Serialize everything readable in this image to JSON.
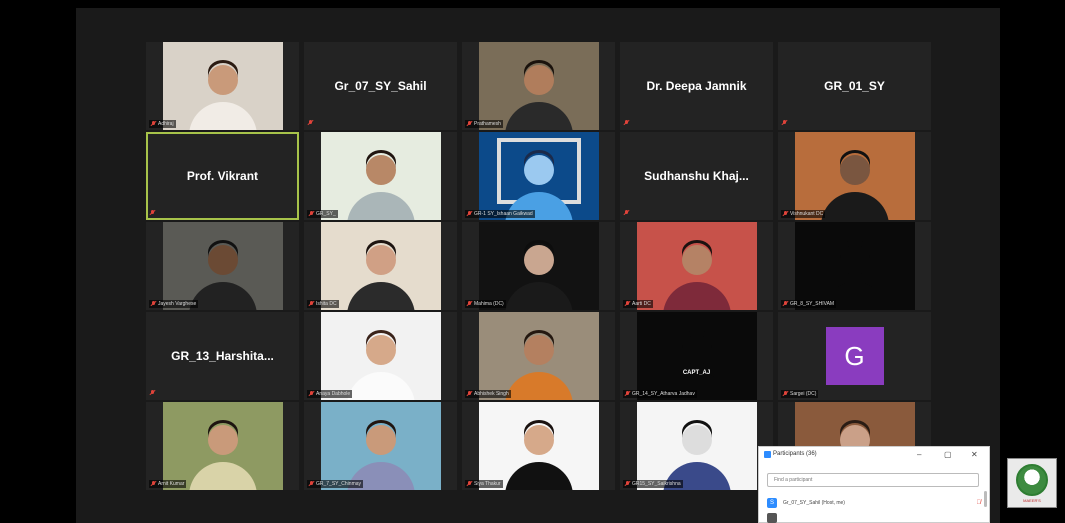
{
  "tiles": [
    {
      "type": "video",
      "label": "Adhiraj",
      "bg": "#d9d2c8",
      "person": "#f1ece6",
      "skin": "#c99a7a",
      "hair": "#2b1b12"
    },
    {
      "type": "name",
      "label": "Gr_07_SY_Sahil"
    },
    {
      "type": "video",
      "label": "Prathamesh",
      "bg": "#7a6d58",
      "person": "#2a2a2a",
      "skin": "#b07d5c",
      "hair": "#1a120c"
    },
    {
      "type": "name",
      "label": "Dr. Deepa Jamnik"
    },
    {
      "type": "name",
      "label": "GR_01_SY"
    },
    {
      "type": "name",
      "label": "Prof. Vikrant",
      "active": true
    },
    {
      "type": "video",
      "label": "GR_SY_",
      "bg": "#e6ece0",
      "person": "#aab6b8",
      "skin": "#b88867",
      "hair": "#201510"
    },
    {
      "type": "video",
      "label": "GR-1 SY_Ishaan Gaikwad",
      "bg": "#0c4a8a",
      "person": "#4aa0e4",
      "skin": "#9bc9f0",
      "hair": "#1b2a4a",
      "frame": "#ddd"
    },
    {
      "type": "name",
      "label": "Sudhanshu Khaj..."
    },
    {
      "type": "video",
      "label": "Vishnukant DC",
      "bg": "#b86d3c",
      "person": "#1a1a1a",
      "skin": "#7a5640",
      "hair": "#111"
    },
    {
      "type": "video",
      "label": "Jayesh Varghese",
      "bg": "#5a5a55",
      "person": "#222",
      "skin": "#6b4a34",
      "hair": "#111"
    },
    {
      "type": "video",
      "label": "Ishita DC",
      "bg": "#e5dccd",
      "person": "#2b2b2b",
      "skin": "#d0a085",
      "hair": "#1d1410"
    },
    {
      "type": "video",
      "label": "Mahima (DC)",
      "bg": "#121212",
      "person": "#1a1a1a",
      "skin": "#c9a690",
      "hair": "#0d0d0d"
    },
    {
      "type": "video",
      "label": "Aarti DC",
      "bg": "#c7524a",
      "person": "#7e2a3a",
      "skin": "#b58265",
      "hair": "#1b1210"
    },
    {
      "type": "video",
      "label": "GR_8_SY_SHIVAM",
      "bg": "#0a0a0a",
      "person": "#0a0a0a",
      "skin": "#0a0a0a",
      "hair": "#0a0a0a"
    },
    {
      "type": "name",
      "label": "GR_13_Harshita..."
    },
    {
      "type": "video",
      "label": "Anaya Dabhole",
      "bg": "#f2f2f2",
      "person": "#fbfbfb",
      "skin": "#d6a98a",
      "hair": "#3a231a"
    },
    {
      "type": "video",
      "label": "Abhishek Singh",
      "bg": "#9a8d7a",
      "person": "#d87a2a",
      "skin": "#b48060",
      "hair": "#241810"
    },
    {
      "type": "video",
      "label": "GR_14_SY_Atharva Jadhav",
      "bg": "#0a0a0a",
      "person": "#0a0a0a",
      "skin": "#0a0a0a",
      "hair": "#0a0a0a",
      "caption": "CAPT_AJ"
    },
    {
      "type": "avatar",
      "label": "Sargei (DC)",
      "initial": "G"
    },
    {
      "type": "video",
      "label": "Arnit Kumar",
      "bg": "#8e9a62",
      "person": "#d9d3a8",
      "skin": "#c99a7a",
      "hair": "#1d1410"
    },
    {
      "type": "video",
      "label": "GR_7_SY_Chinmay",
      "bg": "#7ab0c8",
      "person": "#8a8fb8",
      "skin": "#c99a7a",
      "hair": "#201510"
    },
    {
      "type": "video",
      "label": "Siya Thakur",
      "bg": "#f6f6f6",
      "person": "#111",
      "skin": "#d6a98a",
      "hair": "#1a1210"
    },
    {
      "type": "video",
      "label": "GR15_SY_Saikrishna",
      "bg": "#f5f5f5",
      "person": "#3a4a8a",
      "skin": "#ddd",
      "hair": "#111"
    },
    {
      "type": "video",
      "label": "Nikita",
      "bg": "#8a5a3c",
      "person": "#e8d7cc",
      "skin": "#caa088",
      "hair": "#2a1c14"
    }
  ],
  "panel": {
    "title": "Participants (36)",
    "search_placeholder": "Find a participant",
    "minimize": "–",
    "restore": "▢",
    "close": "✕",
    "rows": [
      {
        "name": "Gr_07_SY_Sahil (Host, me)",
        "initial": "S"
      },
      {
        "name": "",
        "initial": ""
      }
    ]
  },
  "logo": {
    "text": "MAEER'S"
  }
}
